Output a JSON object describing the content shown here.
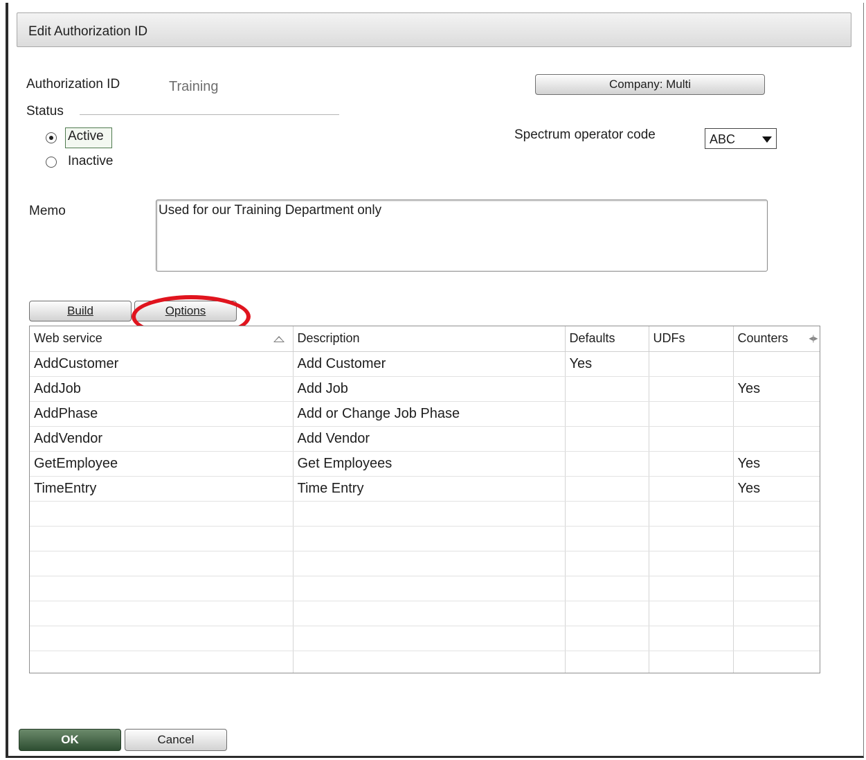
{
  "dialog": {
    "title": "Edit Authorization ID"
  },
  "form": {
    "authorization_id_label": "Authorization ID",
    "authorization_id_value": "Training",
    "company_button_label": "Company: Multi",
    "status_label": "Status",
    "status_options": [
      {
        "label": "Active",
        "selected": true
      },
      {
        "label": "Inactive",
        "selected": false
      }
    ],
    "operator_code_label": "Spectrum operator code",
    "operator_code_value": "ABC",
    "memo_label": "Memo",
    "memo_value": "Used for our Training Department only"
  },
  "tabs": {
    "build_label": "Build",
    "options_label": "Options"
  },
  "grid": {
    "columns": [
      "Web service",
      "Description",
      "Defaults",
      "UDFs",
      "Counters"
    ],
    "rows": [
      [
        "AddCustomer",
        "Add Customer",
        "Yes",
        "",
        ""
      ],
      [
        "AddJob",
        "Add Job",
        "",
        "",
        "Yes"
      ],
      [
        "AddPhase",
        "Add or Change Job Phase",
        "",
        "",
        ""
      ],
      [
        "AddVendor",
        "Add Vendor",
        "",
        "",
        ""
      ],
      [
        "GetEmployee",
        "Get Employees",
        "",
        "",
        "Yes"
      ],
      [
        "TimeEntry",
        "Time Entry",
        "",
        "",
        "Yes"
      ]
    ],
    "empty_rows": 7
  },
  "footer": {
    "ok_label": "OK",
    "cancel_label": "Cancel"
  },
  "colors": {
    "ok_button": "#2e4e32",
    "highlight": "#e0141e"
  }
}
